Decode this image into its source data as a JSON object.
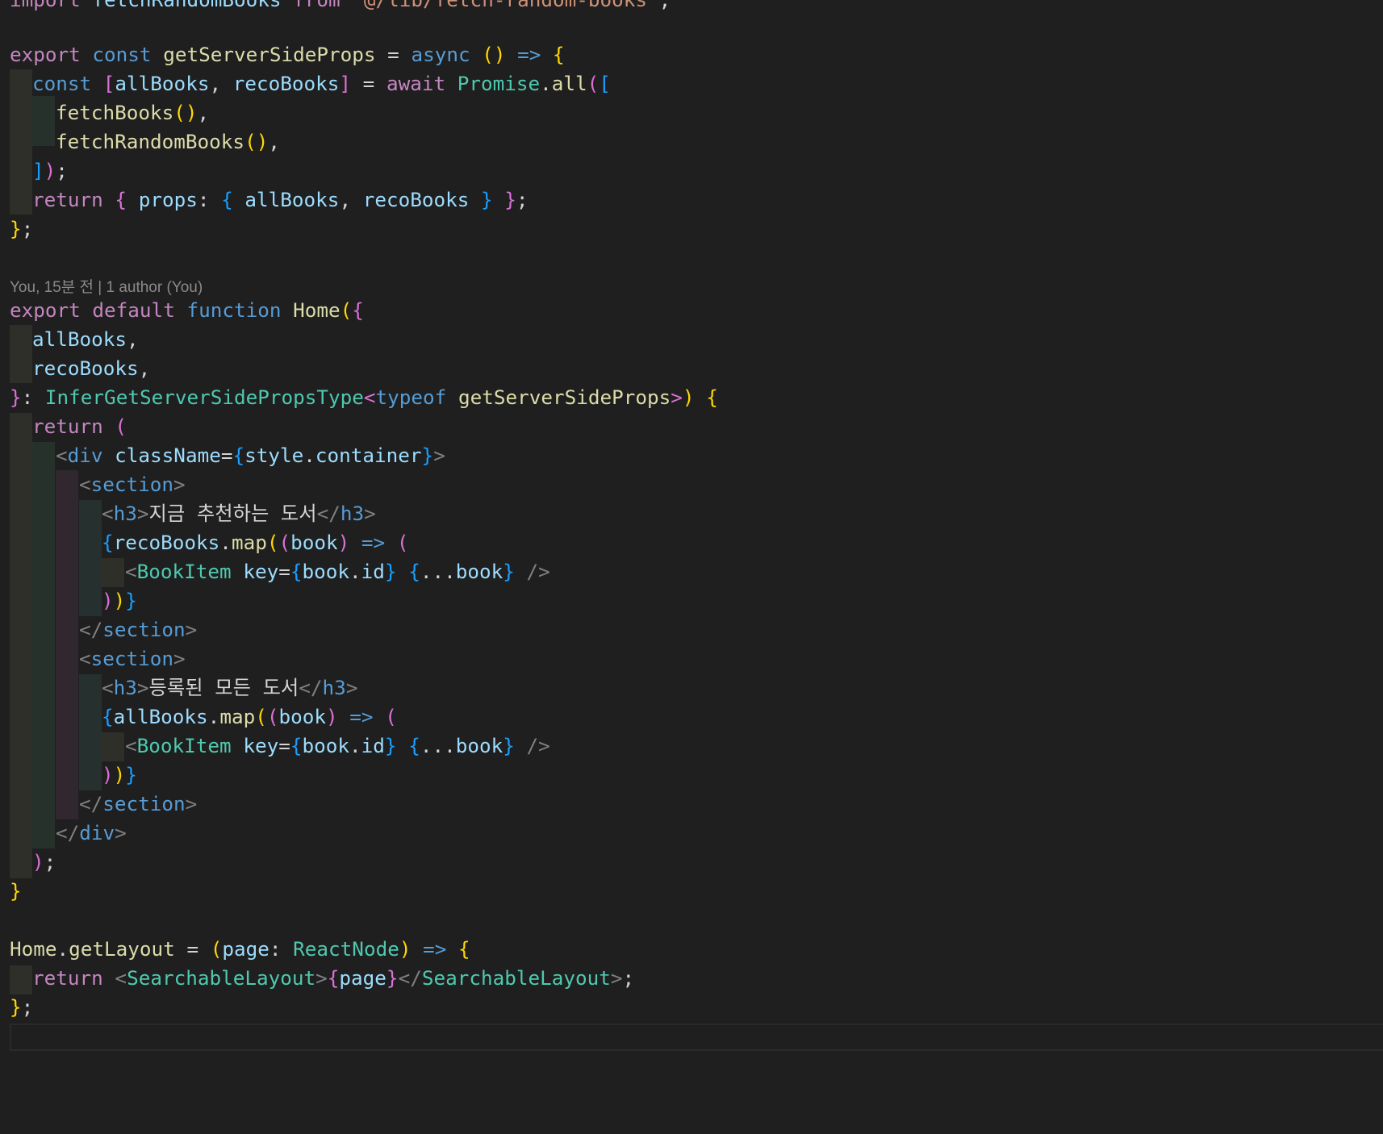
{
  "editor": {
    "language": "typescriptreact",
    "theme_background": "#1f1f1f",
    "blame_annotation": "You, 15분 전 | 1 author (You)",
    "lines": {
      "l0": {
        "kw_import": "import",
        "name": "fetchRandomBooks",
        "kw_from": "from",
        "path": "\"@/lib/fetch-random-books\""
      },
      "l2": {
        "kw_export": "export",
        "kw_const": "const",
        "name": "getServerSideProps",
        "kw_async": "async"
      },
      "l3": {
        "kw_const": "const",
        "var1": "allBooks",
        "var2": "recoBooks",
        "kw_await": "await",
        "cls": "Promise",
        "method": "all"
      },
      "l4": {
        "call": "fetchBooks"
      },
      "l5": {
        "call": "fetchRandomBooks"
      },
      "l7": {
        "kw_return": "return",
        "prop": "props",
        "var1": "allBooks",
        "var2": "recoBooks"
      },
      "l10": {
        "kw_export": "export",
        "kw_default": "default",
        "kw_function": "function",
        "name": "Home"
      },
      "l11": {
        "param": "allBooks"
      },
      "l12": {
        "param": "recoBooks"
      },
      "l13": {
        "type": "InferGetServerSidePropsType",
        "kw_typeof": "typeof",
        "ref": "getServerSideProps"
      },
      "l14": {
        "kw_return": "return"
      },
      "l15": {
        "tag": "div",
        "attr": "className",
        "obj": "style",
        "prop": "container"
      },
      "l16": {
        "tag": "section"
      },
      "l17": {
        "tag": "h3",
        "text": "지금 추천하는 도서"
      },
      "l18": {
        "obj": "recoBooks",
        "method": "map",
        "param": "book"
      },
      "l19": {
        "component": "BookItem",
        "attr": "key",
        "obj": "book",
        "prop": "id",
        "spread": "book"
      },
      "l21": {
        "tag": "section"
      },
      "l22": {
        "tag": "section"
      },
      "l23": {
        "tag": "h3",
        "text": "등록된 모든 도서"
      },
      "l24": {
        "obj": "allBooks",
        "method": "map",
        "param": "book"
      },
      "l25": {
        "component": "BookItem",
        "attr": "key",
        "obj": "book",
        "prop": "id",
        "spread": "book"
      },
      "l27": {
        "tag": "section"
      },
      "l28": {
        "tag": "div"
      },
      "l32": {
        "obj": "Home",
        "prop": "getLayout",
        "param": "page",
        "type": "ReactNode"
      },
      "l33": {
        "kw_return": "return",
        "component": "SearchableLayout",
        "expr": "page"
      }
    }
  }
}
